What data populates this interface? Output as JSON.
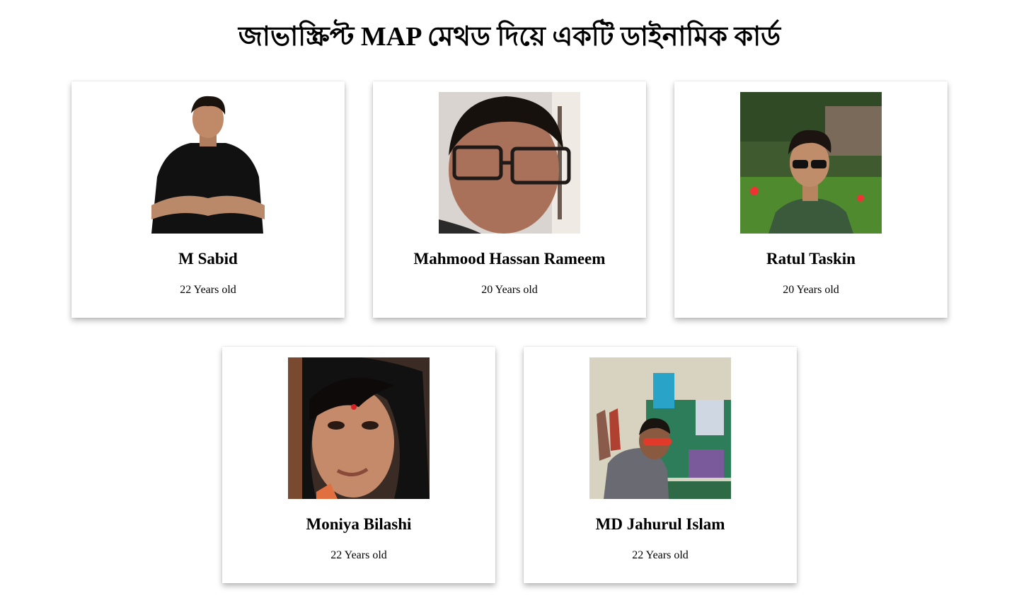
{
  "page": {
    "title": "জাভাস্ক্রিপ্ট MAP মেথড দিয়ে একটি ডাইনামিক কার্ড"
  },
  "cards": [
    {
      "name": "M Sabid",
      "age": "22 Years old"
    },
    {
      "name": "Mahmood Hassan Rameem",
      "age": "20 Years old"
    },
    {
      "name": "Ratul Taskin",
      "age": "20 Years old"
    },
    {
      "name": "Moniya Bilashi",
      "age": "22 Years old"
    },
    {
      "name": "MD Jahurul Islam",
      "age": "22 Years old"
    }
  ]
}
